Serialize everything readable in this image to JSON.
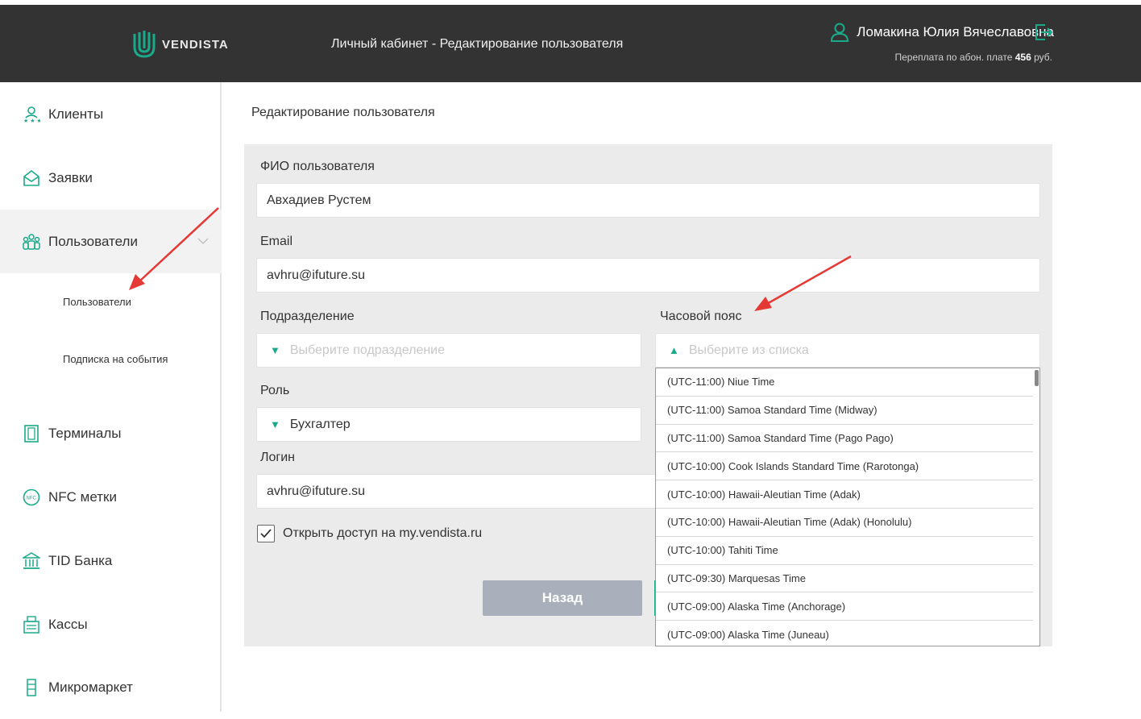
{
  "header": {
    "logo_text": "VENDISTA",
    "title": "Личный кабинет - Редактирование пользователя",
    "user_name": "Ломакина Юлия Вячеславовна",
    "overpay_label": "Переплата по абон. плате",
    "overpay_amount": "456",
    "overpay_currency": "руб."
  },
  "sidebar": {
    "items": [
      {
        "label": "Клиенты",
        "icon": "clients-icon"
      },
      {
        "label": "Заявки",
        "icon": "requests-icon"
      },
      {
        "label": "Пользователи",
        "icon": "users-icon"
      },
      {
        "label": "Терминалы",
        "icon": "terminal-icon"
      },
      {
        "label": "NFC метки",
        "icon": "nfc-icon"
      },
      {
        "label": "TID Банка",
        "icon": "bank-icon"
      },
      {
        "label": "Кассы",
        "icon": "cashbox-icon"
      },
      {
        "label": "Микромаркет",
        "icon": "micromarket-icon"
      }
    ],
    "subitems": [
      "Пользователи",
      "Подписка на события"
    ]
  },
  "main": {
    "title": "Редактирование пользователя",
    "fio_label": "ФИО пользователя",
    "fio_value": "Авхадиев Рустем",
    "email_label": "Email",
    "email_value": "avhru@ifuture.su",
    "division_label": "Подразделение",
    "division_placeholder": "Выберите подразделение",
    "timezone_label": "Часовой пояс",
    "timezone_placeholder": "Выберите из списка",
    "role_label": "Роль",
    "role_value": "Бухгалтер",
    "login_label": "Логин",
    "login_value": "avhru@ifuture.su",
    "access_label": "Открыть доступ на my.vendista.ru",
    "access_checked": true,
    "back_button": "Назад"
  },
  "timezone_options": [
    "(UTC-11:00) Niue Time",
    "(UTC-11:00) Samoa Standard Time (Midway)",
    "(UTC-11:00) Samoa Standard Time (Pago Pago)",
    "(UTC-10:00) Cook Islands Standard Time (Rarotonga)",
    "(UTC-10:00) Hawaii-Aleutian Time (Adak)",
    "(UTC-10:00) Hawaii-Aleutian Time (Adak) (Honolulu)",
    "(UTC-10:00) Tahiti Time",
    "(UTC-09:30) Marquesas Time",
    "(UTC-09:00) Alaska Time (Anchorage)",
    "(UTC-09:00) Alaska Time (Juneau)"
  ],
  "colors": {
    "header_bg": "#333333",
    "accent": "#1aaa8a",
    "annotation_arrow": "#e53935"
  }
}
